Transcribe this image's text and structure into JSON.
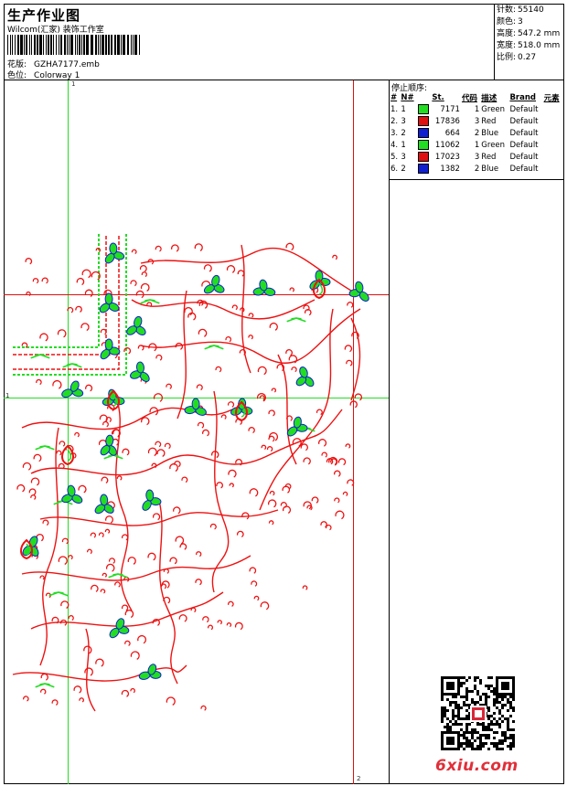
{
  "header": {
    "title": "生产作业图",
    "subtitle": "Wilcom(汇家) 装饰工作室",
    "design_label": "花版:",
    "design_value": "GZHA7177.emb",
    "colorway_label": "色位:",
    "colorway_value": "Colorway 1"
  },
  "stats": [
    {
      "label": "针数:",
      "value": "55140"
    },
    {
      "label": "颜色:",
      "value": "3"
    },
    {
      "label": "高度:",
      "value": "547.2 mm"
    },
    {
      "label": "宽度:",
      "value": "518.0 mm"
    },
    {
      "label": "比例:",
      "value": "0.27"
    }
  ],
  "stop_sequence": {
    "title": "停止顺序:",
    "headers": [
      "#",
      "N#",
      "St.",
      "代码",
      "描述",
      "Brand",
      "元素"
    ],
    "rows": [
      {
        "num": "1.",
        "n": "1",
        "color": "#22dd22",
        "st": "7171",
        "code": "1",
        "desc": "Green",
        "brand": "Default"
      },
      {
        "num": "2.",
        "n": "3",
        "color": "#e01010",
        "st": "17836",
        "code": "3",
        "desc": "Red",
        "brand": "Default"
      },
      {
        "num": "3.",
        "n": "2",
        "color": "#1020d0",
        "st": "664",
        "code": "2",
        "desc": "Blue",
        "brand": "Default"
      },
      {
        "num": "4.",
        "n": "1",
        "color": "#22dd22",
        "st": "11062",
        "code": "1",
        "desc": "Green",
        "brand": "Default"
      },
      {
        "num": "5.",
        "n": "3",
        "color": "#e01010",
        "st": "17023",
        "code": "3",
        "desc": "Red",
        "brand": "Default"
      },
      {
        "num": "6.",
        "n": "2",
        "color": "#1020d0",
        "st": "1382",
        "code": "2",
        "desc": "Blue",
        "brand": "Default"
      }
    ]
  },
  "guides": {
    "top_v_label": "1",
    "left_h_label": "1",
    "bottom_v_label": "2"
  },
  "colors": {
    "green_guide": "#22dd22",
    "red_guide": "#e01010",
    "red": "#ee1111",
    "green": "#22dd22",
    "blue": "#1020d0"
  },
  "watermark": "6xiu.com"
}
